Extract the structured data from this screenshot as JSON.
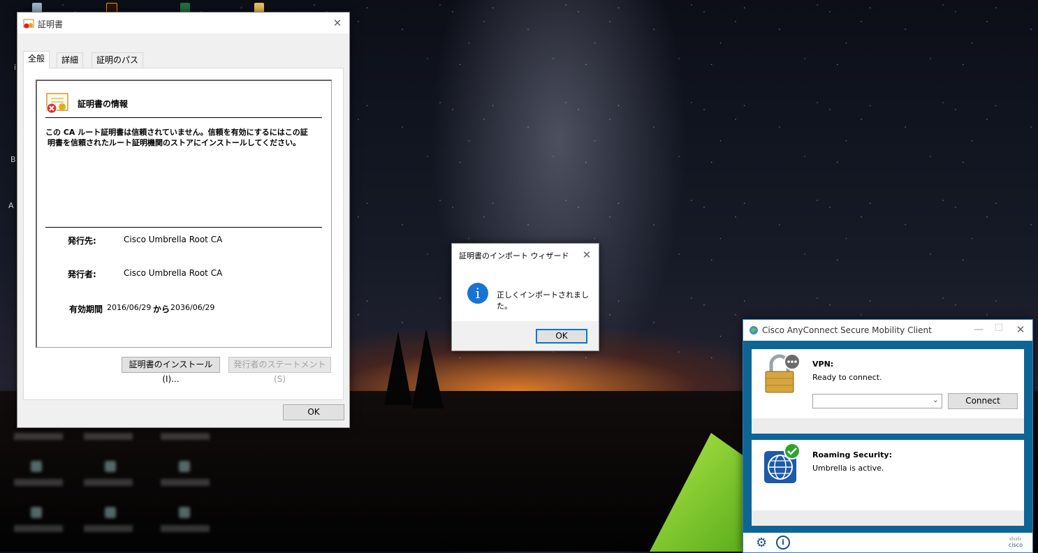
{
  "desktop": {
    "side_texts": [
      "i",
      "B",
      "A"
    ]
  },
  "cert_dialog": {
    "title": "証明書",
    "tabs": [
      {
        "label": "全般"
      },
      {
        "label": "詳細"
      },
      {
        "label": "証明のパス"
      }
    ],
    "heading": "証明書の情報",
    "message_line1": "この CA ルート証明書は信頼されていません。信頼を有効にするにはこの証",
    "message_line2": "明書を信頼されたルート証明機関のストアにインストールしてください。",
    "issued_to_label": "発行先:",
    "issued_to_value": "Cisco Umbrella Root CA",
    "issued_by_label": "発行者:",
    "issued_by_value": "Cisco Umbrella Root CA",
    "validity_label": "有効期間",
    "valid_from": "2016/06/29",
    "from_to_word": "から",
    "valid_to": "2036/06/29",
    "install_button": "証明書のインストール(I)...",
    "statement_button": "発行者のステートメント(S)",
    "ok_button": "OK"
  },
  "import_wizard": {
    "title": "証明書のインポート ウィザード",
    "message": "正しくインポートされました。",
    "ok_button": "OK",
    "icon_glyph": "i"
  },
  "anyconnect": {
    "title": "Cisco AnyConnect Secure Mobility Client",
    "vpn": {
      "heading": "VPN:",
      "status": "Ready to connect.",
      "server_value": "",
      "connect_button": "Connect"
    },
    "roaming": {
      "heading": "Roaming Security:",
      "status": "Umbrella is active."
    },
    "footer": {
      "logo_text": "cisco"
    }
  },
  "colors": {
    "accent_blue": "#0078d7",
    "cisco_blue": "#0d6596",
    "info_blue": "#1874d2",
    "success_green": "#2ca52c"
  }
}
